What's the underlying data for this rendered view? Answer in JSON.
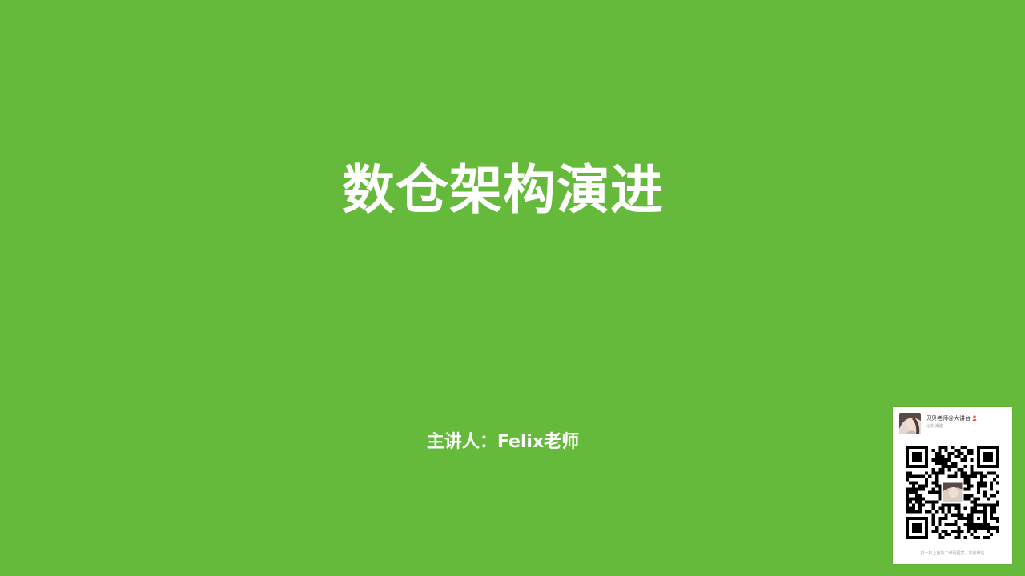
{
  "slide": {
    "background_color": "#65b93b",
    "title": "数仓架构演进",
    "presenter": "主讲人：Felix老师"
  },
  "qr_card": {
    "account_name": "贝贝老师@大讲台",
    "location": "北京 海淀",
    "caption": "扫一扫上面的二维码图案，加我微信",
    "badge_icon": "person-icon",
    "avatar_icon": "profile-photo"
  }
}
